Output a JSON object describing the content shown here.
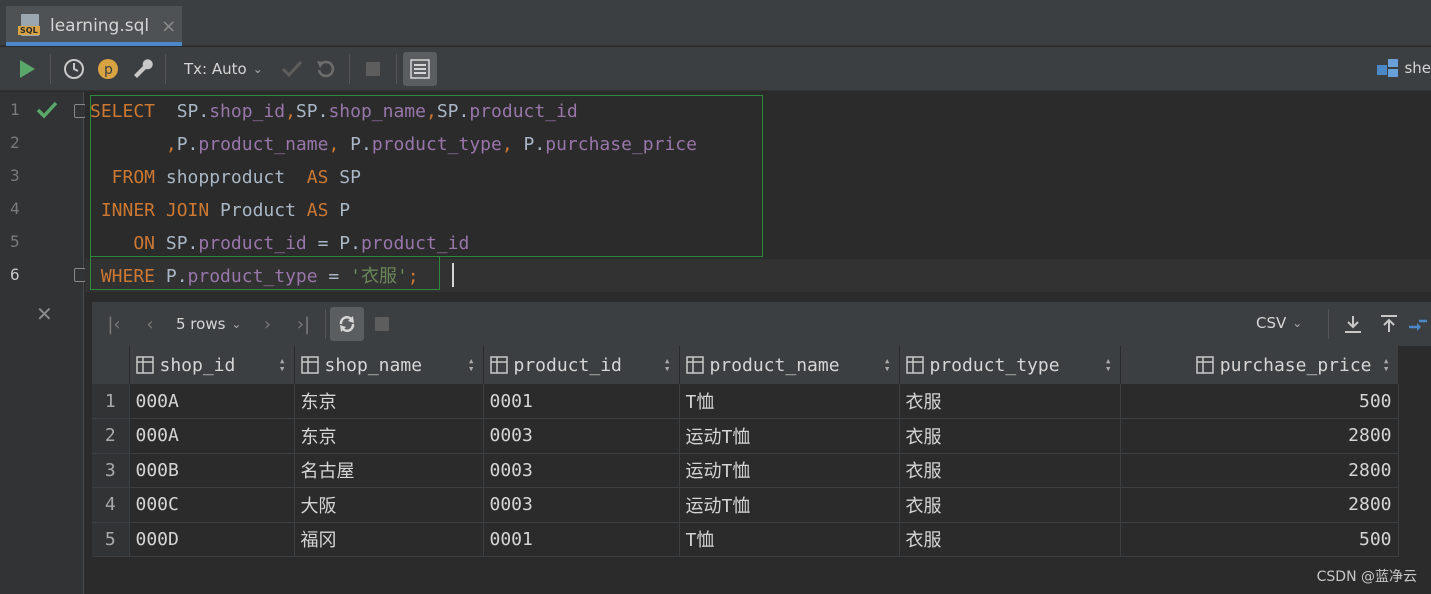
{
  "tab": {
    "title": "learning.sql",
    "icon": "sql-file-icon",
    "close": "×"
  },
  "toolbar": {
    "tx_mode": "Tx: Auto",
    "session_label": "she"
  },
  "gutter": {
    "line_numbers": [
      "1",
      "2",
      "3",
      "4",
      "5",
      "6"
    ]
  },
  "editor": {
    "lines": [
      [
        {
          "t": "SELECT",
          "c": "kw"
        },
        {
          "t": "  SP.",
          "c": ""
        },
        {
          "t": "shop_id",
          "c": "fld"
        },
        {
          "t": ",",
          "c": "punct"
        },
        {
          "t": "SP.",
          "c": ""
        },
        {
          "t": "shop_name",
          "c": "fld"
        },
        {
          "t": ",",
          "c": "punct"
        },
        {
          "t": "SP.",
          "c": ""
        },
        {
          "t": "product_id",
          "c": "fld"
        }
      ],
      [
        {
          "t": "       ",
          "c": ""
        },
        {
          "t": ",",
          "c": "punct"
        },
        {
          "t": "P.",
          "c": ""
        },
        {
          "t": "product_name",
          "c": "fld"
        },
        {
          "t": ", ",
          "c": "punct"
        },
        {
          "t": "P.",
          "c": ""
        },
        {
          "t": "product_type",
          "c": "fld"
        },
        {
          "t": ", ",
          "c": "punct"
        },
        {
          "t": "P.",
          "c": ""
        },
        {
          "t": "purchase_price",
          "c": "fld"
        }
      ],
      [
        {
          "t": "  FROM",
          "c": "kw"
        },
        {
          "t": " shopproduct  ",
          "c": ""
        },
        {
          "t": "AS",
          "c": "kw"
        },
        {
          "t": " SP",
          "c": ""
        }
      ],
      [
        {
          "t": " INNER JOIN",
          "c": "kw"
        },
        {
          "t": " Product ",
          "c": ""
        },
        {
          "t": "AS",
          "c": "kw"
        },
        {
          "t": " P",
          "c": ""
        }
      ],
      [
        {
          "t": "    ON",
          "c": "kw"
        },
        {
          "t": " SP.",
          "c": ""
        },
        {
          "t": "product_id",
          "c": "fld"
        },
        {
          "t": " = P.",
          "c": ""
        },
        {
          "t": "product_id",
          "c": "fld"
        }
      ],
      [
        {
          "t": " WHERE",
          "c": "kw"
        },
        {
          "t": " P.",
          "c": ""
        },
        {
          "t": "product_type",
          "c": "fld"
        },
        {
          "t": " = ",
          "c": ""
        },
        {
          "t": "'衣服'",
          "c": "str"
        },
        {
          "t": ";",
          "c": "punct"
        }
      ]
    ]
  },
  "results": {
    "rows_label": "5 rows",
    "export_format": "CSV",
    "columns": [
      "shop_id",
      "shop_name",
      "product_id",
      "product_name",
      "product_type",
      "purchase_price"
    ],
    "rows": [
      [
        "1",
        "000A",
        "东京",
        "0001",
        "T恤",
        "衣服",
        "500"
      ],
      [
        "2",
        "000A",
        "东京",
        "0003",
        "运动T恤",
        "衣服",
        "2800"
      ],
      [
        "3",
        "000B",
        "名古屋",
        "0003",
        "运动T恤",
        "衣服",
        "2800"
      ],
      [
        "4",
        "000C",
        "大阪",
        "0003",
        "运动T恤",
        "衣服",
        "2800"
      ],
      [
        "5",
        "000D",
        "福冈",
        "0001",
        "T恤",
        "衣服",
        "500"
      ]
    ]
  },
  "watermark": "CSDN @蓝净云",
  "colors": {
    "keyword": "#cc7832",
    "field": "#9876aa",
    "string": "#6a8759",
    "run": "#59a869",
    "accent_tab": "#4a88c7"
  }
}
